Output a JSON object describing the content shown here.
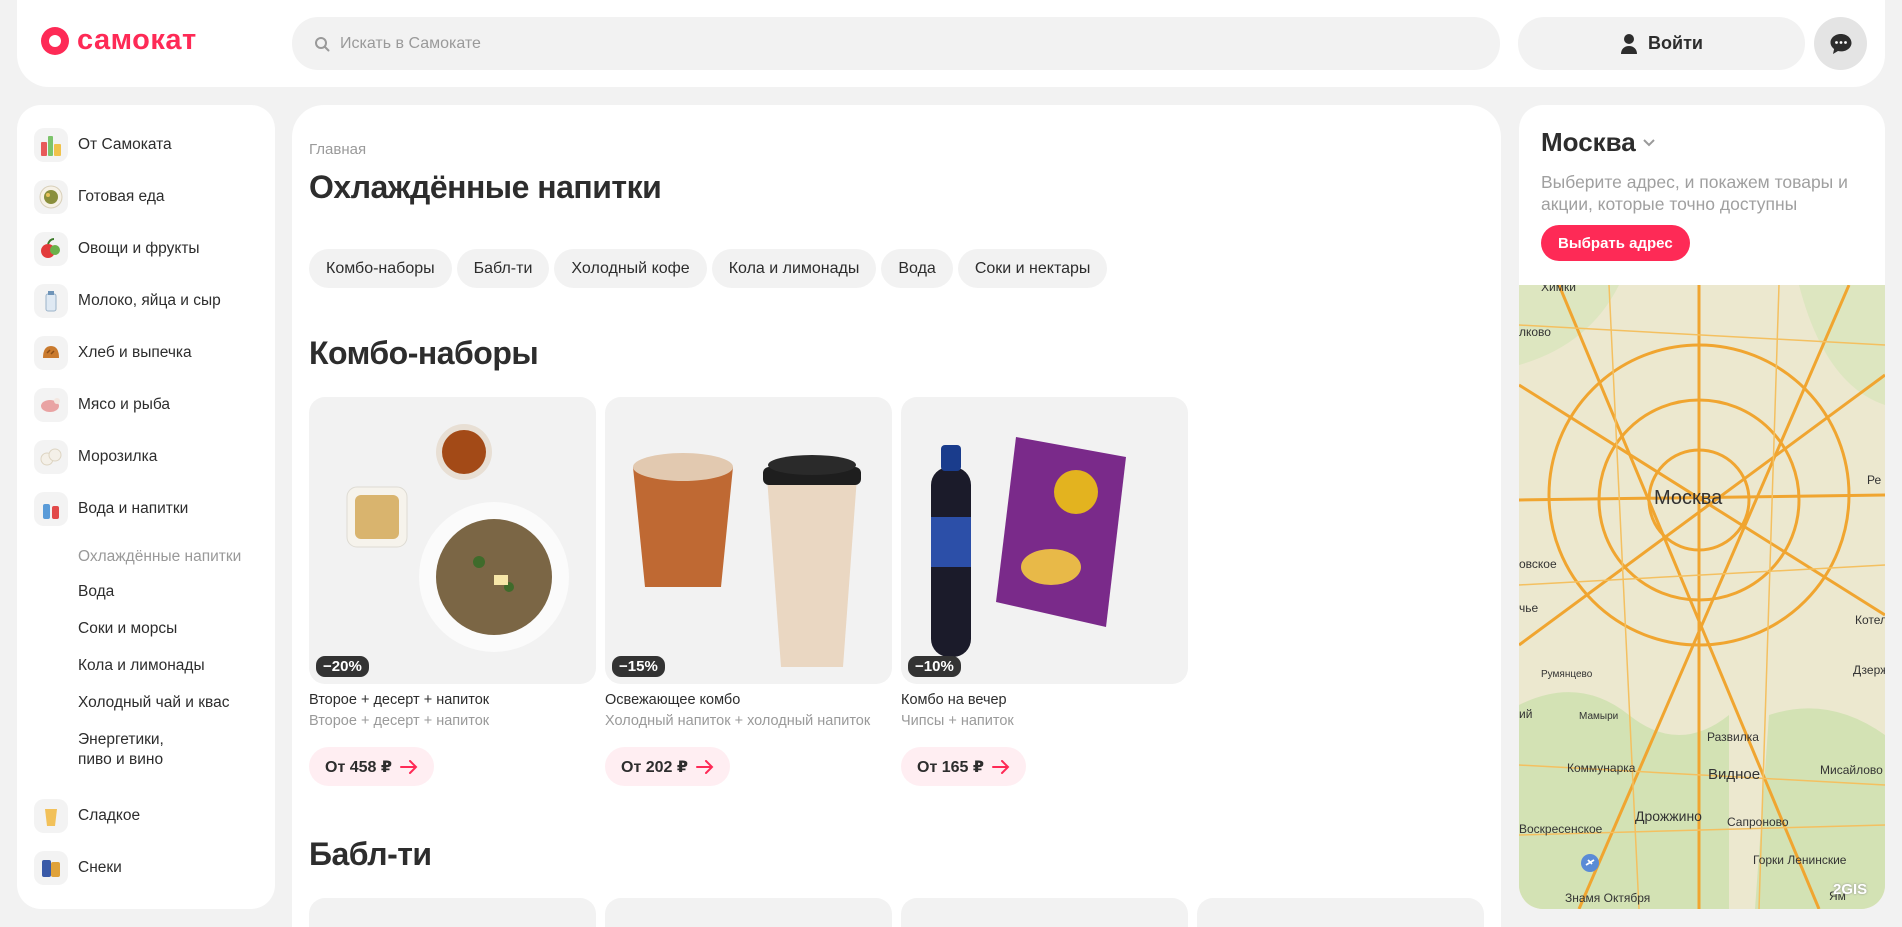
{
  "header": {
    "logo_text": "самокат",
    "search_placeholder": "Искать в Самокате",
    "login_label": "Войти"
  },
  "sidebar": {
    "categories": [
      {
        "label": "От Самоката",
        "icon": "samokat-products-icon"
      },
      {
        "label": "Готовая еда",
        "icon": "ready-food-icon"
      },
      {
        "label": "Овощи и фрукты",
        "icon": "vegetables-icon"
      },
      {
        "label": "Молоко, яйца и сыр",
        "icon": "milk-icon"
      },
      {
        "label": "Хлеб и выпечка",
        "icon": "bread-icon"
      },
      {
        "label": "Мясо и рыба",
        "icon": "meat-icon"
      },
      {
        "label": "Морозилка",
        "icon": "frozen-icon"
      },
      {
        "label": "Вода и напитки",
        "icon": "drinks-icon"
      }
    ],
    "subcategories": [
      {
        "label": "Охлаждённые напитки",
        "active": true
      },
      {
        "label": "Вода"
      },
      {
        "label": "Соки и морсы"
      },
      {
        "label": "Кола и лимонады"
      },
      {
        "label": "Холодный чай и квас"
      },
      {
        "label": "Энергетики, пиво и вино"
      }
    ],
    "more_categories": [
      {
        "label": "Сладкое",
        "icon": "sweets-icon"
      },
      {
        "label": "Снеки",
        "icon": "snacks-icon"
      }
    ]
  },
  "main": {
    "breadcrumb": "Главная",
    "title": "Охлаждённые напитки",
    "chips": [
      "Комбо-наборы",
      "Бабл-ти",
      "Холодный кофе",
      "Кола и лимонады",
      "Вода",
      "Соки и нектары"
    ],
    "section1_title": "Комбо-наборы",
    "section2_title": "Бабл-ти",
    "products": [
      {
        "name": "Второе + десерт + напиток",
        "desc": "Второе + десерт + напиток",
        "discount": "−20%",
        "price": "От 458 ₽"
      },
      {
        "name": "Освежающее комбо",
        "desc": "Холодный напиток + холодный напиток",
        "discount": "−15%",
        "price": "От 202 ₽"
      },
      {
        "name": "Комбо на вечер",
        "desc": "Чипсы + напиток",
        "discount": "−10%",
        "price": "От 165 ₽"
      }
    ]
  },
  "address": {
    "city": "Москва",
    "hint": "Выберите адрес, и покажем товары и акции, которые точно доступны",
    "button": "Выбрать адрес"
  },
  "map": {
    "city_label": "Москва",
    "labels": [
      "Химки",
      "лково",
      "овское",
      "чье",
      "Румянцево",
      "ий",
      "Мамыри",
      "Коммунарка",
      "Воскресенское",
      "Дрожжино",
      "Развилка",
      "Видное",
      "Сапроново",
      "Мисайлово",
      "Котел",
      "Дзерж",
      "Ре",
      "Горки Ленинские",
      "Знамя Октября",
      "Ям"
    ],
    "attribution": "2GIS"
  },
  "colors": {
    "brand": "#fe2a56",
    "background": "#f2f2f2"
  }
}
